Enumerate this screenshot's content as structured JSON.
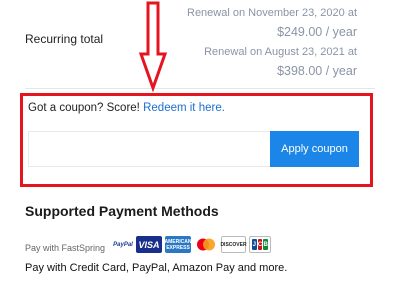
{
  "recurring": {
    "label": "Recurring total",
    "renewals": [
      {
        "date": "Renewal on November 23, 2020 at",
        "price": "$249.00 / year"
      },
      {
        "date": "Renewal on August 23, 2021 at",
        "price": "$398.00 / year"
      }
    ]
  },
  "coupon": {
    "prompt": "Got a coupon? Score!",
    "link": "Redeem it here.",
    "input_value": "",
    "input_placeholder": "",
    "apply_label": "Apply coupon"
  },
  "payment": {
    "heading": "Supported Payment Methods",
    "pay_with": "Pay with FastSpring",
    "description": "Pay with Credit Card, PayPal, Amazon Pay and more.",
    "logos": [
      "PayPal",
      "VISA",
      "AMERICAN EXPRESS",
      "mastercard",
      "DISCOVER",
      "JCB"
    ]
  },
  "colors": {
    "accent": "#1b86e8",
    "highlight": "#e4151f",
    "link": "#1b6fd1"
  },
  "icons": [
    "down-arrow-annotation-icon"
  ]
}
